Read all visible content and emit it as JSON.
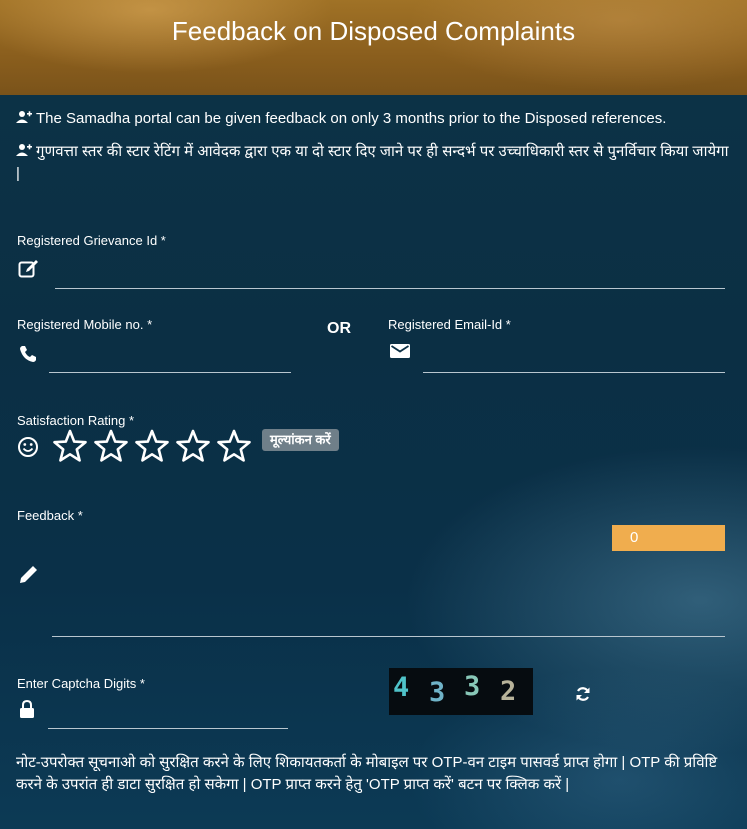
{
  "header": {
    "title": "Feedback on Disposed Complaints"
  },
  "notes": [
    "The Samadha portal can be given feedback on only 3 months prior to the Disposed references.",
    "गुणवत्ता स्तर की स्टार रेटिंग में आवेदक द्वारा एक या दो स्टार दिए जाने पर ही सन्दर्भ पर उच्चाधिकारी स्तर से पुनर्विचार किया जायेगा |"
  ],
  "form": {
    "grievance_id": {
      "label": "Registered Grievance Id *",
      "value": ""
    },
    "mobile": {
      "label": "Registered Mobile no. *",
      "value": ""
    },
    "or_label": "OR",
    "email": {
      "label": "Registered Email-Id *",
      "value": ""
    },
    "rating": {
      "label": "Satisfaction Rating *",
      "stars_total": 5,
      "stars_selected": 0,
      "button_label": "मूल्यांकन करें"
    },
    "feedback": {
      "label": "Feedback *",
      "value": "",
      "char_count": "0"
    },
    "captcha": {
      "label": "Enter Captcha Digits *",
      "value": "",
      "digits": [
        "4",
        "3",
        "3",
        "2"
      ]
    }
  },
  "bottom_note": "नोट-उपरोक्त सूचनाओ को सुरक्षित करने के लिए शिकायतकर्ता के मोबाइल पर OTP-वन टाइम पासवर्ड प्राप्त होगा | OTP की प्रविष्टि करने के उपरांत ही डाटा सुरक्षित हो सकेगा | OTP प्राप्त करने हेतु 'OTP प्राप्त करें' बटन पर क्लिक करें |",
  "colors": {
    "header": "#8a5e1d",
    "background": "#0b2f44",
    "counter": "#f0ad4e",
    "rate_button": "#6f7f89"
  },
  "icons": [
    "user-plus-icon",
    "edit-icon",
    "phone-icon",
    "mail-icon",
    "smile-icon",
    "star-icon",
    "pencil-icon",
    "lock-icon",
    "refresh-icon"
  ]
}
